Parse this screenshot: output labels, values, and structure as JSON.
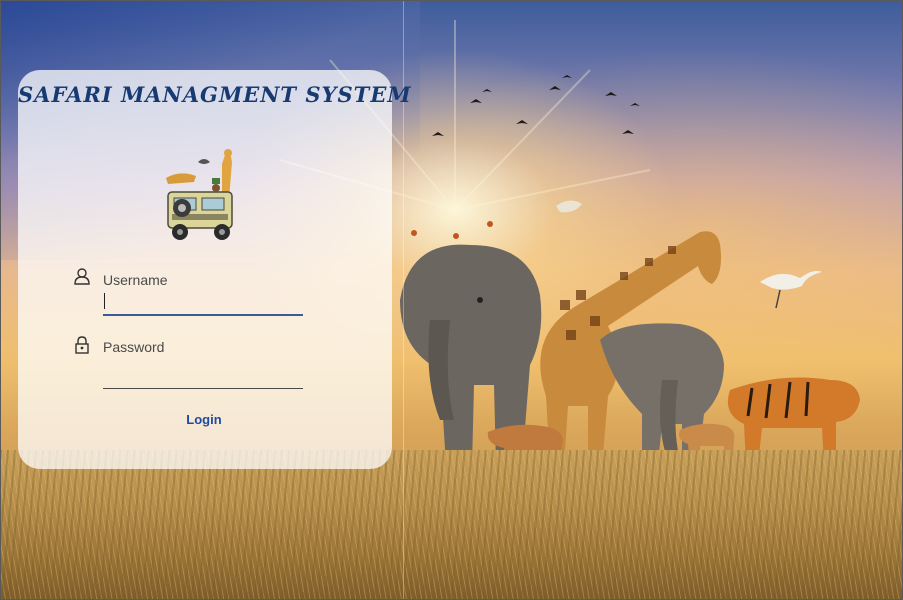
{
  "app": {
    "title": "SAFARI MANAGMENT SYSTEM"
  },
  "form": {
    "username": {
      "label": "Username",
      "value": "",
      "placeholder": "",
      "icon": "user-icon"
    },
    "password": {
      "label": "Password",
      "value": "",
      "placeholder": "",
      "icon": "lock-icon"
    },
    "login_label": "Login"
  },
  "theme": {
    "title_color": "#173a72",
    "accent": "#1e4aa0",
    "underline_active": "#3a5a9a",
    "underline_inactive": "#4a4a4a"
  }
}
